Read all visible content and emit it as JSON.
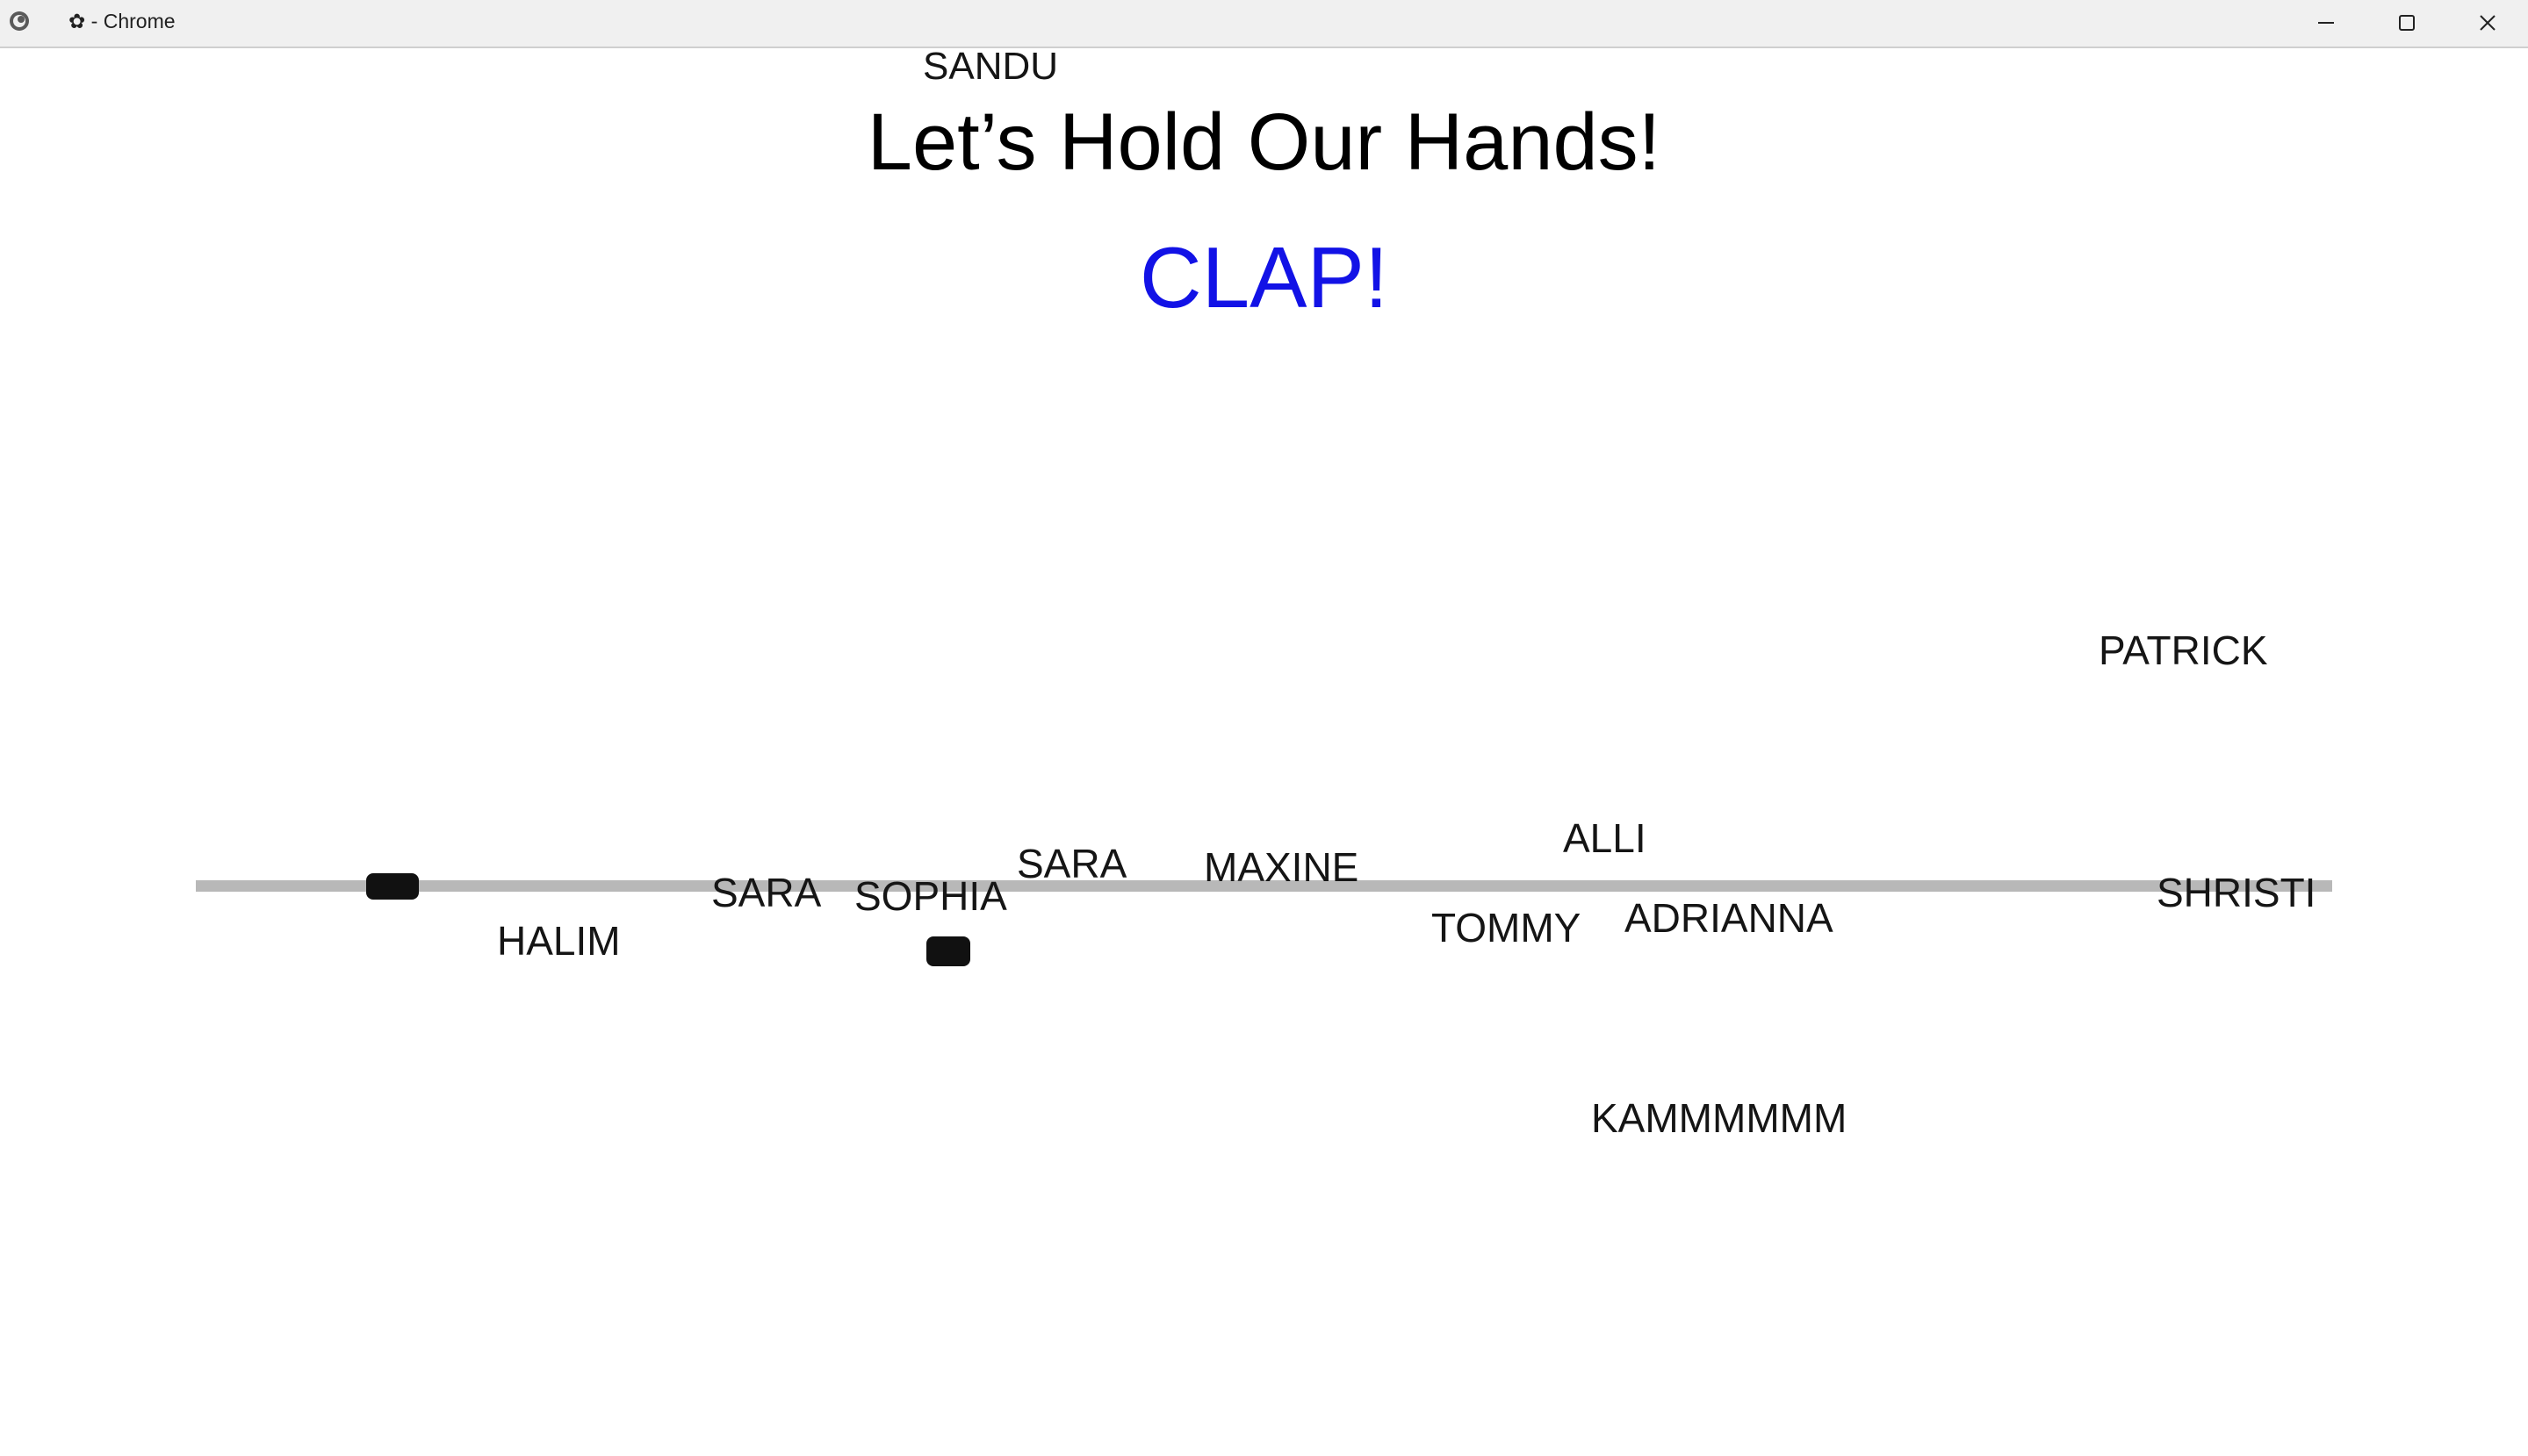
{
  "window": {
    "title": "✿ - Chrome",
    "app_icon": "browser-globe-icon",
    "controls": [
      "minimize-icon",
      "maximize-icon",
      "close-icon"
    ]
  },
  "page": {
    "title": "Let’s Hold Our Hands!",
    "clap_label": "CLAP!",
    "clap_color": "#1212e6",
    "line_color": "#b8b8b8"
  },
  "names": {
    "sandu": "SANDU",
    "patrick": "PATRICK",
    "alli": "ALLI",
    "sara_top": "SARA",
    "maxine": "MAXINE",
    "sara_left": "SARA",
    "sophia": "SOPHIA",
    "shristi": "SHRISTI",
    "halim": "HALIM",
    "tommy": "TOMMY",
    "adrianna": "ADRIANNA",
    "kammmmmm": "KAMMMMMM"
  }
}
